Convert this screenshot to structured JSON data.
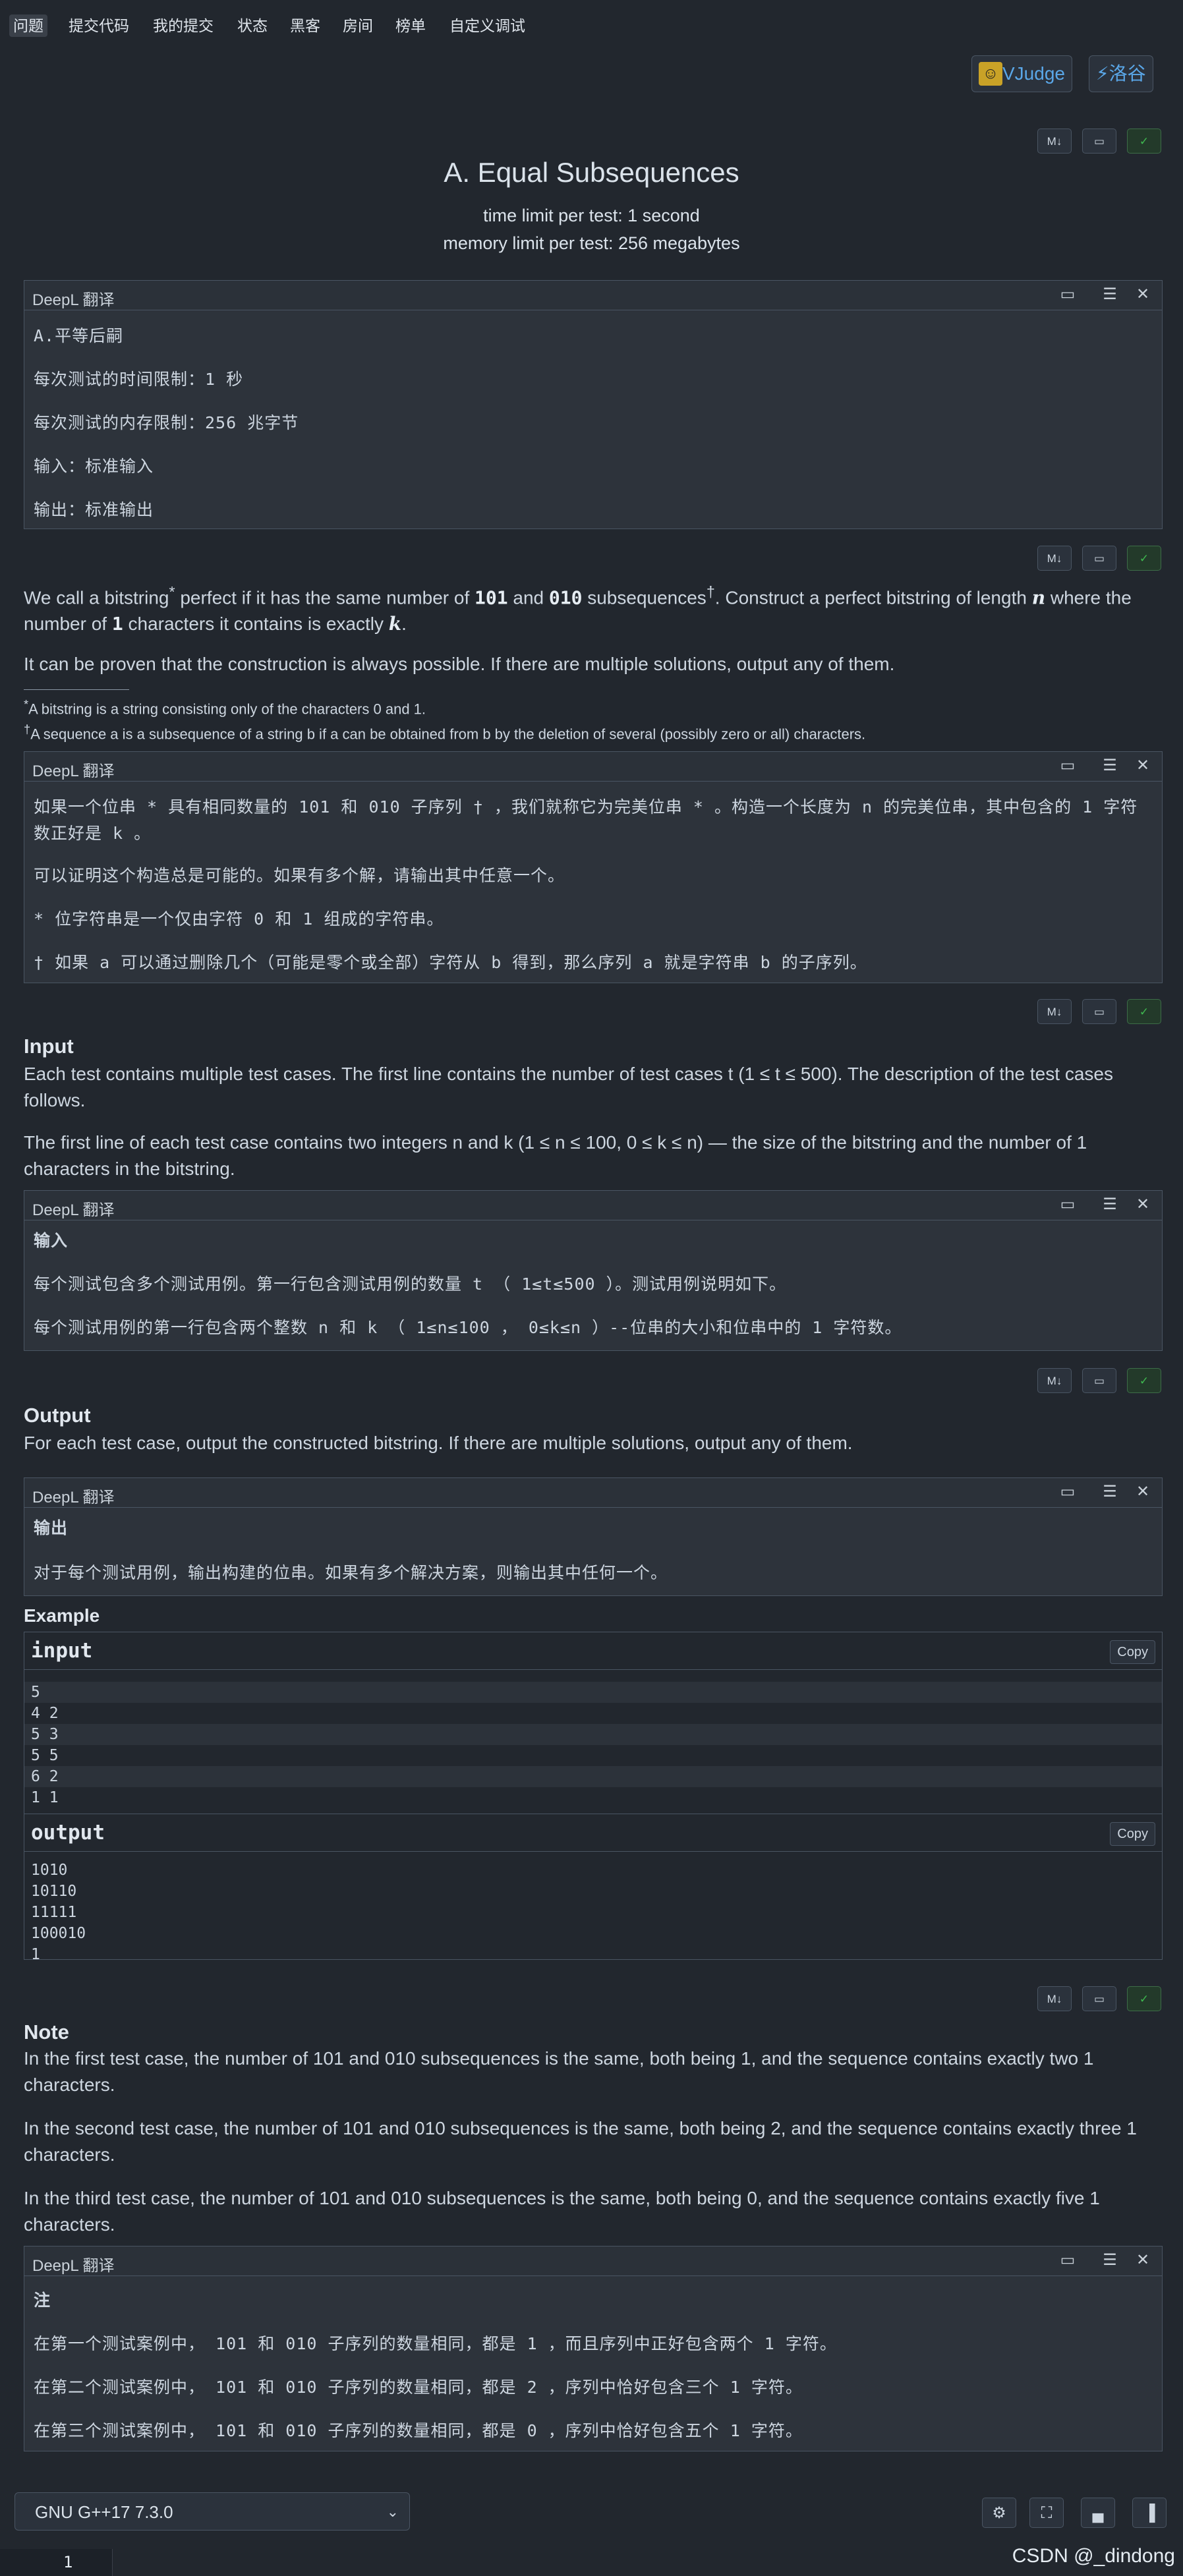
{
  "nav": [
    "问题",
    "提交代码",
    "我的提交",
    "状态",
    "黑客",
    "房间",
    "榜单",
    "自定义调试"
  ],
  "judges": {
    "vjudge": "VJudge",
    "luogu": "洛谷"
  },
  "toolbar": {
    "md": "M↓",
    "copy_icon": "clipboard-icon",
    "toggle_icon": "check-icon"
  },
  "problem": {
    "title": "A. Equal Subsequences",
    "time_limit": "time limit per test: 1 second",
    "memory_limit": "memory limit per test: 256 megabytes"
  },
  "deepl_label": "DeepL 翻译",
  "translation1": [
    "A.平等后嗣",
    "每次测试的时间限制：1 秒",
    "每次测试的内存限制：256 兆字节",
    "输入：标准输入",
    "输出：标准输出"
  ],
  "statement": {
    "p1_a": "We call a bitstring",
    "p1_b": " perfect if it has the same number of ",
    "p1_101": "101",
    "p1_c": " and ",
    "p1_010": "010",
    "p1_d": " subsequences",
    "p1_e": ". Construct a perfect bitstring of length ",
    "p1_n": "n",
    "p1_f": " where the number of ",
    "p1_1": "1",
    "p1_g": " characters it contains is exactly ",
    "p1_k": "k",
    "p1_h": ".",
    "p2": "It can be proven that the construction is always possible. If there are multiple solutions, output any of them.",
    "fn1": "A bitstring is a string consisting only of the characters 0 and 1.",
    "fn2": "A sequence a is a subsequence of a string b if a can be obtained from b by the deletion of several (possibly zero or all) characters."
  },
  "translation2": [
    "如果一个位串 * 具有相同数量的 101 和 010 子序列 † ，我们就称它为完美位串 * 。构造一个长度为 n 的完美位串，其中包含的 1 字符数正好是 k 。",
    "可以证明这个构造总是可能的。如果有多个解，请输出其中任意一个。",
    "* 位字符串是一个仅由字符 0 和 1 组成的字符串。",
    "† 如果 a 可以通过删除几个（可能是零个或全部）字符从 b 得到，那么序列 a 就是字符串 b 的子序列。"
  ],
  "input_section": {
    "heading": "Input",
    "p1": "Each test contains multiple test cases. The first line contains the number of test cases t (1 ≤ t ≤ 500). The description of the test cases follows.",
    "p2": "The first line of each test case contains two integers n and k (1 ≤ n ≤ 100, 0 ≤ k ≤ n) — the size of the bitstring and the number of 1 characters in the bitstring."
  },
  "translation3": [
    "输入",
    "每个测试包含多个测试用例。第一行包含测试用例的数量 t （ 1≤t≤500 ）。测试用例说明如下。",
    "每个测试用例的第一行包含两个整数 n 和 k （ 1≤n≤100 ， 0≤k≤n ）--位串的大小和位串中的 1 字符数。"
  ],
  "output_section": {
    "heading": "Output",
    "p1": "For each test case, output the constructed bitstring. If there are multiple solutions, output any of them."
  },
  "translation4": [
    "输出",
    "对于每个测试用例，输出构建的位串。如果有多个解决方案，则输出其中任何一个。"
  ],
  "example": {
    "heading": "Example",
    "input_title": "input",
    "output_title": "output",
    "copy": "Copy",
    "input_lines": [
      "5",
      "4 2",
      "5 3",
      "5 5",
      "6 2",
      "1 1"
    ],
    "output_lines": [
      "1010",
      "10110",
      "11111",
      "100010",
      "1"
    ]
  },
  "note": {
    "heading": "Note",
    "p1": "In the first test case, the number of 101 and 010 subsequences is the same, both being 1, and the sequence contains exactly two 1 characters.",
    "p2": "In the second test case, the number of 101 and 010 subsequences is the same, both being 2, and the sequence contains exactly three 1 characters.",
    "p3": "In the third test case, the number of 101 and 010 subsequences is the same, both being 0, and the sequence contains exactly five 1 characters."
  },
  "translation5": [
    "注",
    "在第一个测试案例中， 101 和 010 子序列的数量相同，都是 1 ，而且序列中正好包含两个 1 字符。",
    "在第二个测试案例中， 101 和 010 子序列的数量相同，都是 2 ，序列中恰好包含三个 1 字符。",
    "在第三个测试案例中， 101 和 010 子序列的数量相同，都是 0 ，序列中恰好包含五个 1 字符。"
  ],
  "editor": {
    "language": "GNU G++17 7.3.0",
    "line_number": "1"
  },
  "watermark": "CSDN @_dindong"
}
